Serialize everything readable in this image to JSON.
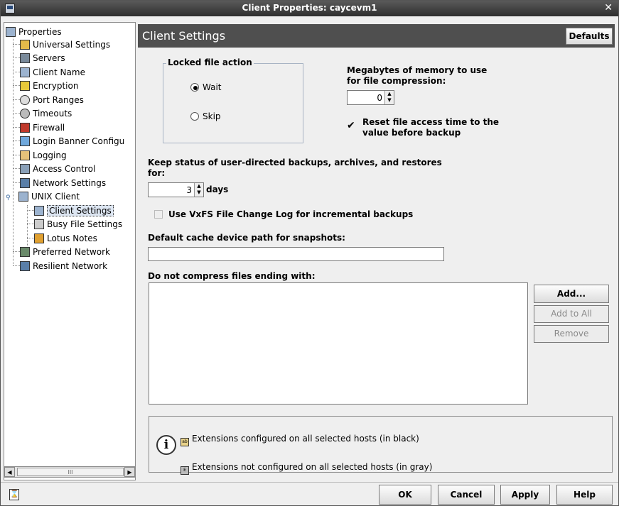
{
  "window": {
    "title": "Client Properties: caycevm1"
  },
  "tree": {
    "items": [
      {
        "label": "Properties",
        "icon": "computer-icon"
      },
      {
        "label": "Universal Settings",
        "icon": "settings-icon"
      },
      {
        "label": "Servers",
        "icon": "server-icon"
      },
      {
        "label": "Client Name",
        "icon": "computer-icon"
      },
      {
        "label": "Encryption",
        "icon": "lock-icon"
      },
      {
        "label": "Port Ranges",
        "icon": "port-icon"
      },
      {
        "label": "Timeouts",
        "icon": "clock-icon"
      },
      {
        "label": "Firewall",
        "icon": "firewall-icon"
      },
      {
        "label": "Login Banner Configu",
        "icon": "banner-icon"
      },
      {
        "label": "Logging",
        "icon": "log-icon"
      },
      {
        "label": "Access Control",
        "icon": "access-icon"
      },
      {
        "label": "Network Settings",
        "icon": "network-icon"
      },
      {
        "label": "UNIX Client",
        "icon": "computer-icon"
      },
      {
        "label": "Client Settings",
        "icon": "computer-icon"
      },
      {
        "label": "Busy File Settings",
        "icon": "busy-file-icon"
      },
      {
        "label": "Lotus Notes",
        "icon": "lotus-icon"
      },
      {
        "label": "Preferred Network",
        "icon": "network-icon"
      },
      {
        "label": "Resilient Network",
        "icon": "network-icon"
      }
    ],
    "scroll_thumb": "III"
  },
  "header": {
    "title": "Client Settings",
    "defaults": "Defaults"
  },
  "locked_file": {
    "title": "Locked file action",
    "options": [
      "Wait",
      "Skip"
    ],
    "selected": "Wait"
  },
  "memory": {
    "label1": "Megabytes of memory to use",
    "label2": "for file compression:",
    "value": "0"
  },
  "reset_access": {
    "line1": "Reset file access time to the",
    "line2": "value before backup",
    "checked": true
  },
  "keep_status": {
    "line1": "Keep status of user-directed backups, archives, and restores",
    "line2": "for:",
    "value": "3",
    "unit": "days"
  },
  "vxfs": {
    "label": "Use VxFS File Change Log for incremental backups",
    "checked": false
  },
  "cache_path": {
    "label": "Default cache device path for snapshots:",
    "value": ""
  },
  "no_compress": {
    "label": "Do not compress files ending with:"
  },
  "list_buttons": {
    "add": "Add...",
    "add_to_all": "Add to All",
    "remove": "Remove"
  },
  "legend": {
    "black": "Extensions configured on all selected hosts (in black)",
    "gray": "Extensions not configured on all selected hosts (in gray)"
  },
  "footer": {
    "ok": "OK",
    "cancel": "Cancel",
    "apply": "Apply",
    "help": "Help"
  }
}
